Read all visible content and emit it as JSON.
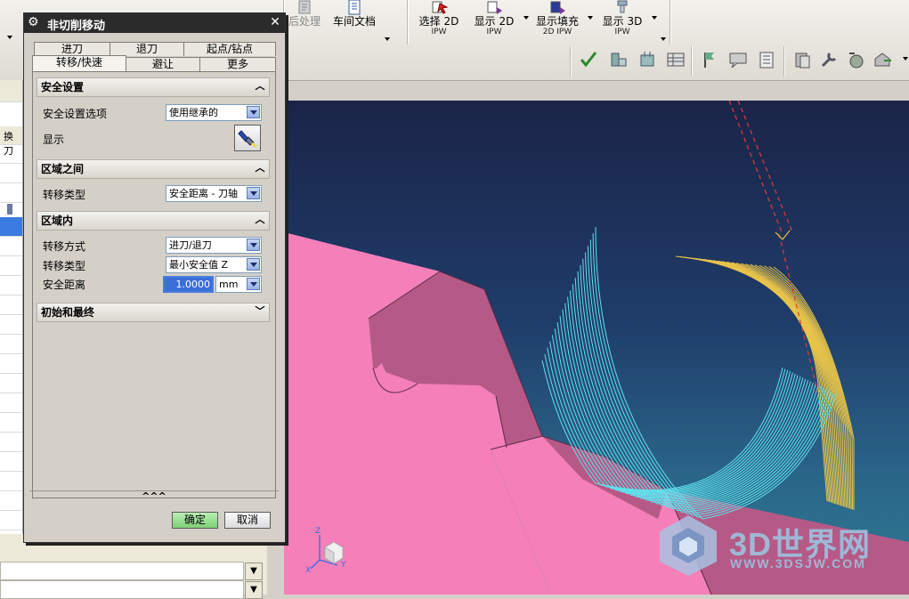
{
  "toolbar": {
    "items": [
      {
        "label": "后处理",
        "icon": "postprocess-icon"
      },
      {
        "label": "车间文档",
        "icon": "shop-doc-icon"
      },
      {
        "label": "选择 2D",
        "sub": "IPW",
        "icon": "select-2d-ipw-icon"
      },
      {
        "label": "显示 2D",
        "sub": "IPW",
        "icon": "display-2d-ipw-icon"
      },
      {
        "label": "显示填充",
        "sub": "2D IPW",
        "icon": "display-fill-2d-ipw-icon"
      },
      {
        "label": "显示 3D",
        "sub": "IPW",
        "icon": "display-3d-ipw-icon"
      }
    ]
  },
  "navigator": {
    "header_label": "换刀"
  },
  "dialog": {
    "title": "非切削移动",
    "tabs_row1": [
      "进刀",
      "退刀",
      "起点/钻点"
    ],
    "tabs_row2": [
      "转移/快速",
      "避让",
      "更多"
    ],
    "active_tab": "转移/快速",
    "sections": {
      "safety": {
        "title": "安全设置",
        "option_label": "安全设置选项",
        "option_value": "使用继承的",
        "display_label": "显示"
      },
      "between_regions": {
        "title": "区域之间",
        "transfer_type_label": "转移类型",
        "transfer_type_value": "安全距离 - 刀轴"
      },
      "within_region": {
        "title": "区域内",
        "transfer_method_label": "转移方式",
        "transfer_method_value": "进刀/退刀",
        "transfer_type_label": "转移类型",
        "transfer_type_value": "最小安全值 Z",
        "safe_distance_label": "安全距离",
        "safe_distance_value": "1.0000",
        "safe_distance_unit": "mm"
      },
      "initial_final": {
        "title": "初始和最终"
      }
    },
    "collapse_glyph": "^^^",
    "ok_label": "确定",
    "cancel_label": "取消"
  },
  "watermark": {
    "brand": "3D世界网",
    "url": "WWW.3DSJW.COM"
  },
  "colors": {
    "part_face_light": "#f47fb9",
    "part_face_dark": "#b55a86",
    "toolpath_cyan": "#5fe3ef",
    "toolpath_yellow": "#e8c44a",
    "rapid_red": "#e23a3a",
    "ok_button": "#8fd98a"
  }
}
